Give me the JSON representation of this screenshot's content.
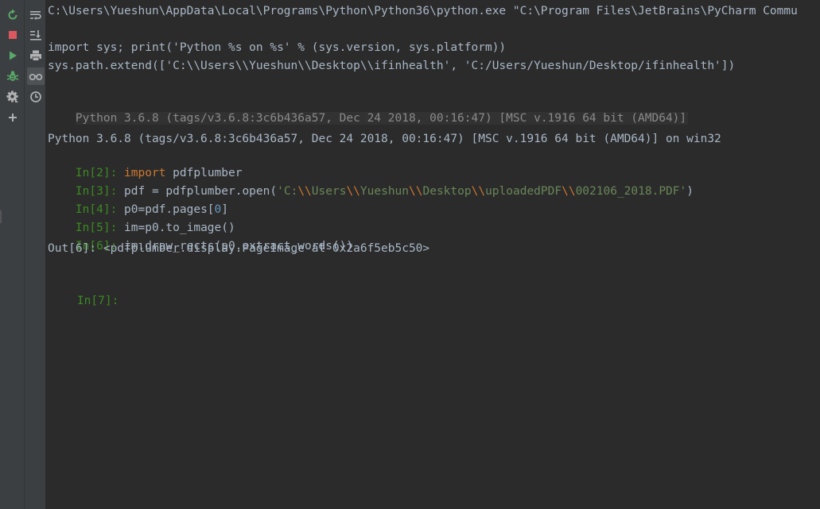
{
  "command_line": "C:\\Users\\Yueshun\\AppData\\Local\\Programs\\Python\\Python36\\python.exe \"C:\\Program Files\\JetBrains\\PyCharm Commu",
  "startup": {
    "line1": "import sys; print('Python %s on %s' % (sys.version, sys.platform))",
    "line2": "sys.path.extend(['C:\\\\Users\\\\Yueshun\\\\Desktop\\\\ifinhealth', 'C:/Users/Yueshun/Desktop/ifinhealth'])"
  },
  "banner": "Python 3.6.8 (tags/v3.6.8:3c6b436a57, Dec 24 2018, 00:16:47) [MSC v.1916 64 bit (AMD64)]",
  "version_line": "Python 3.6.8 (tags/v3.6.8:3c6b436a57, Dec 24 2018, 00:16:47) [MSC v.1916 64 bit (AMD64)] on win32",
  "inputs": [
    {
      "prompt": "In[2]:",
      "parts": [
        {
          "t": " ",
          "c": "txt"
        },
        {
          "t": "import",
          "c": "kw"
        },
        {
          "t": " pdfplumber",
          "c": "txt"
        }
      ]
    },
    {
      "prompt": "In[3]:",
      "parts": [
        {
          "t": " pdf = pdfplumber.open(",
          "c": "txt"
        },
        {
          "t": "'C:",
          "c": "str"
        },
        {
          "t": "\\\\",
          "c": "esc"
        },
        {
          "t": "Users",
          "c": "str"
        },
        {
          "t": "\\\\",
          "c": "esc"
        },
        {
          "t": "Yueshun",
          "c": "str"
        },
        {
          "t": "\\\\",
          "c": "esc"
        },
        {
          "t": "Desktop",
          "c": "str"
        },
        {
          "t": "\\\\",
          "c": "esc"
        },
        {
          "t": "uploadedPDF",
          "c": "str"
        },
        {
          "t": "\\\\",
          "c": "esc"
        },
        {
          "t": "002106_2018.PDF'",
          "c": "str"
        },
        {
          "t": ")",
          "c": "txt"
        }
      ]
    },
    {
      "prompt": "In[4]:",
      "parts": [
        {
          "t": " p0=pdf.pages[",
          "c": "txt"
        },
        {
          "t": "0",
          "c": "num"
        },
        {
          "t": "]",
          "c": "txt"
        }
      ]
    },
    {
      "prompt": "In[5]:",
      "parts": [
        {
          "t": " im=p0.to_image()",
          "c": "txt"
        }
      ]
    },
    {
      "prompt": "In[6]:",
      "parts": [
        {
          "t": " im.draw_rects(p0.extract_words())",
          "c": "txt"
        }
      ]
    }
  ],
  "output": "Out[6]: <pdfplumber.display.PageImage at 0x2a6f5eb5c50>",
  "current_prompt": "In[7]:",
  "left_toolbar": [
    {
      "name": "rerun-icon",
      "color": "#59a869"
    },
    {
      "name": "stop-icon",
      "color": "#db5860"
    },
    {
      "name": "run-icon",
      "color": "#59a869"
    },
    {
      "name": "debug-icon",
      "color": "#59a869"
    },
    {
      "name": "settings-icon",
      "color": "#afb1b3"
    },
    {
      "name": "add-icon",
      "color": "#afb1b3"
    }
  ],
  "right_toolbar": [
    {
      "name": "soft-wrap-icon",
      "color": "#afb1b3"
    },
    {
      "name": "scroll-to-end-icon",
      "color": "#afb1b3"
    },
    {
      "name": "print-icon",
      "color": "#afb1b3"
    },
    {
      "name": "show-variables-icon",
      "color": "#afb1b3",
      "active": true
    },
    {
      "name": "history-icon",
      "color": "#afb1b3"
    }
  ]
}
